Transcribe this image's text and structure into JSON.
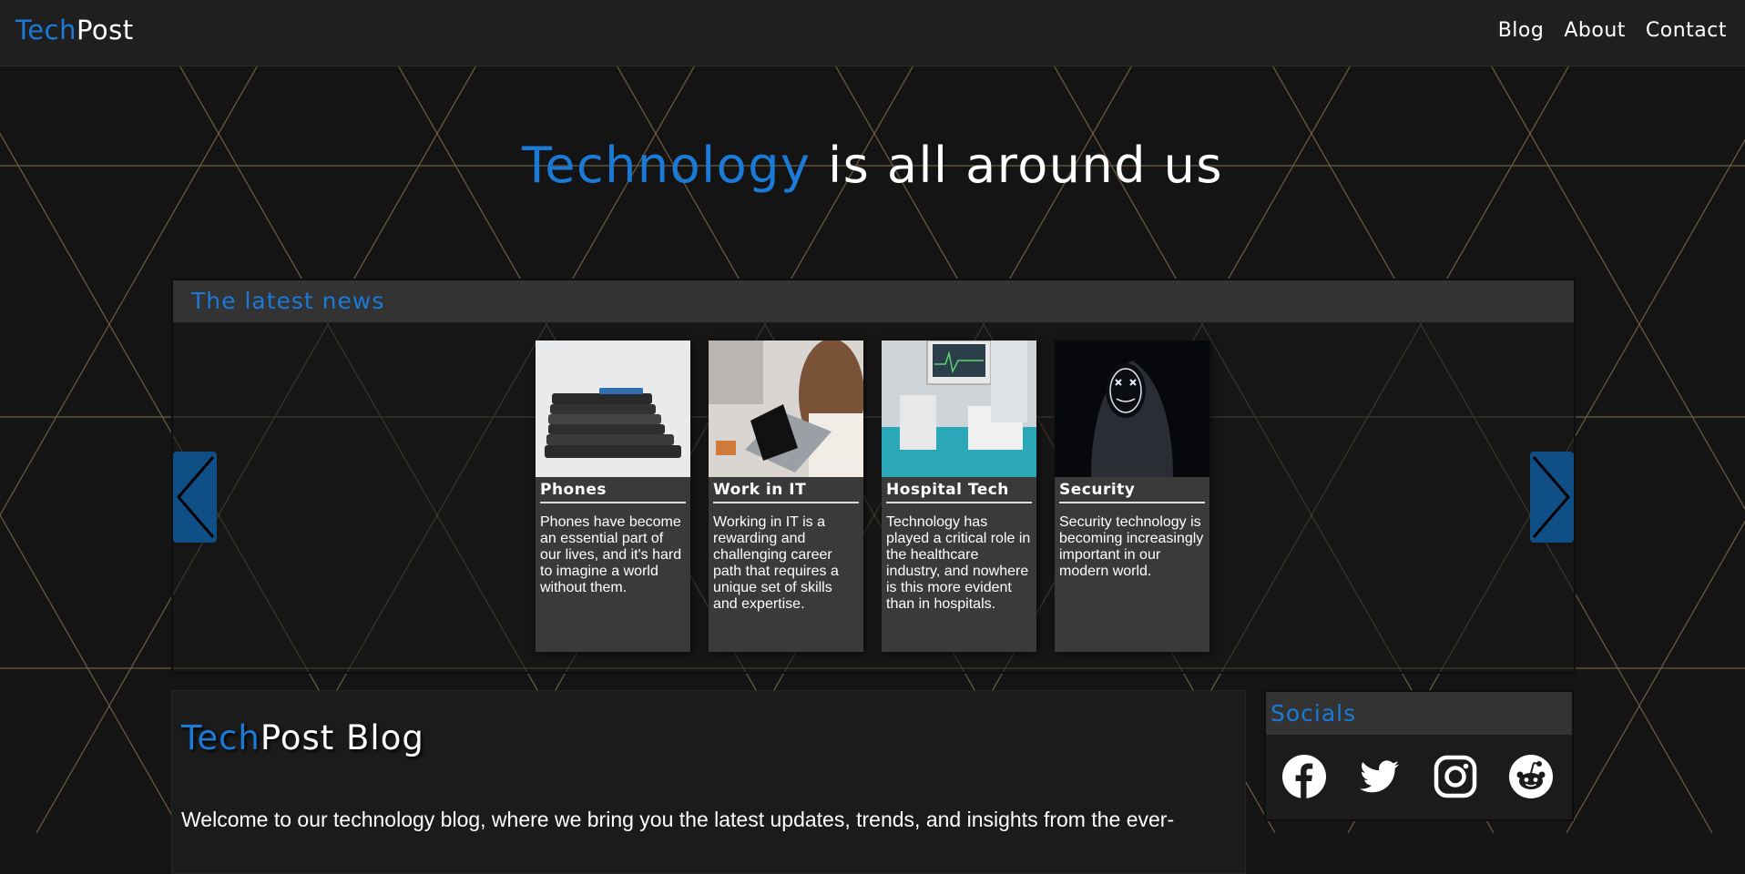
{
  "nav": {
    "brand_part1": "Tech",
    "brand_part2": "Post",
    "links": [
      "Blog",
      "About",
      "Contact"
    ]
  },
  "hero": {
    "highlight": "Technology",
    "rest": " is all around us"
  },
  "news": {
    "title": "The latest news",
    "cards": [
      {
        "title": "Phones",
        "text": "Phones have become an essential part of our lives, and it's hard to imagine a world without them."
      },
      {
        "title": "Work in IT",
        "text": "Working in IT is a rewarding and challenging career path that requires a unique set of skills and expertise."
      },
      {
        "title": "Hospital Tech",
        "text": "Technology has played a critical role in the healthcare industry, and nowhere is this more evident than in hospitals."
      },
      {
        "title": "Security",
        "text": "Security technology is becoming increasingly important in our modern world."
      }
    ]
  },
  "blog": {
    "title_part1": "Tech",
    "title_part2": "Post Blog",
    "intro": "Welcome to our technology blog, where we bring you the latest updates, trends, and insights from the ever-"
  },
  "socials": {
    "title": "Socials",
    "icons": [
      "facebook-icon",
      "twitter-icon",
      "instagram-icon",
      "reddit-icon"
    ]
  },
  "colors": {
    "accent": "#1a7ad6",
    "arrow": "#0f4f86",
    "background": "#141414"
  }
}
